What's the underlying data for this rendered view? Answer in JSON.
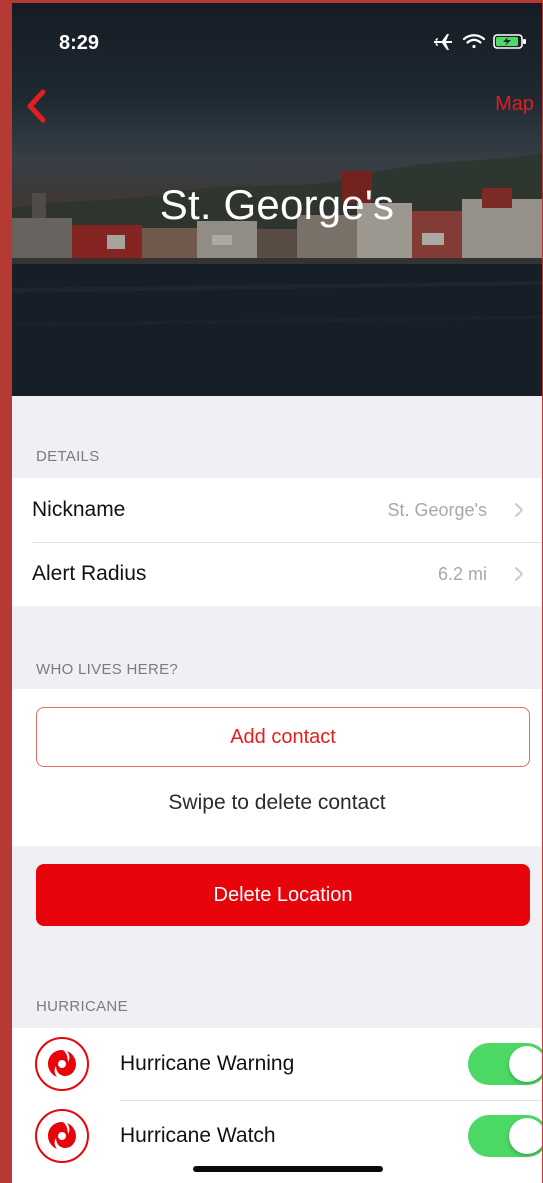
{
  "status_bar": {
    "time": "8:29",
    "icons": [
      "airplane-icon",
      "wifi-icon",
      "battery-charging-icon"
    ]
  },
  "nav": {
    "back_icon": "chevron-left-icon",
    "map_label": "Map"
  },
  "hero": {
    "title": "St. George's"
  },
  "details": {
    "header": "DETAILS",
    "rows": [
      {
        "label": "Nickname",
        "value": "St. George's"
      },
      {
        "label": "Alert Radius",
        "value": "6.2 mi"
      }
    ]
  },
  "contacts": {
    "header": "WHO LIVES HERE?",
    "add_label": "Add contact",
    "hint": "Swipe to delete contact"
  },
  "delete": {
    "label": "Delete Location"
  },
  "hurricane": {
    "header": "HURRICANE",
    "rows": [
      {
        "label": "Hurricane Warning",
        "icon": "hurricane-icon",
        "enabled": true
      },
      {
        "label": "Hurricane Watch",
        "icon": "hurricane-icon",
        "enabled": true
      }
    ]
  },
  "colors": {
    "accent": "#e8040b",
    "toggle_on": "#4cd964",
    "background": "#efeff4"
  }
}
